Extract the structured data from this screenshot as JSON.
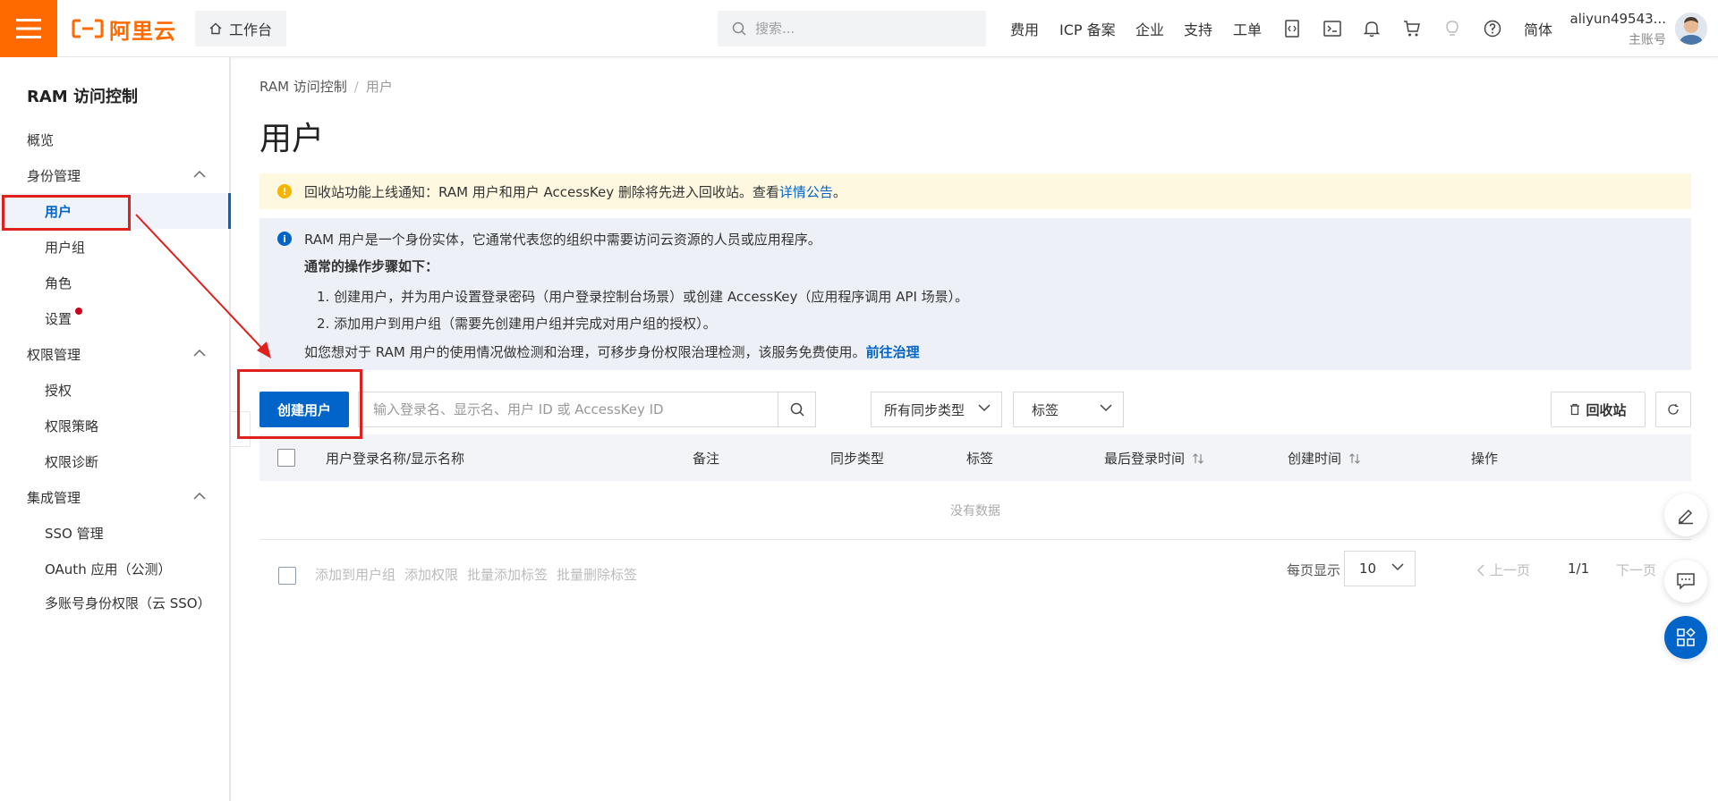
{
  "header": {
    "brand": "阿里云",
    "workbench_label": "工作台",
    "search_placeholder": "搜索...",
    "nav": [
      "费用",
      "ICP 备案",
      "企业",
      "支持",
      "工单"
    ],
    "language": "简体",
    "account_name": "aliyun49543...",
    "account_role": "主账号"
  },
  "sidebar": {
    "title": "RAM 访问控制",
    "overview": "概览",
    "group_identity": "身份管理",
    "users": "用户",
    "user_groups": "用户组",
    "roles": "角色",
    "settings": "设置",
    "group_permissions": "权限管理",
    "authorization": "授权",
    "policies": "权限策略",
    "diagnosis": "权限诊断",
    "group_integration": "集成管理",
    "sso": "SSO 管理",
    "oauth": "OAuth 应用（公测）",
    "cloud_sso": "多账号身份权限（云 SSO）"
  },
  "main": {
    "breadcrumb_root": "RAM 访问控制",
    "breadcrumb_sep": "/",
    "breadcrumb_current": "用户",
    "title": "用户",
    "warn_text": "回收站功能上线通知：RAM 用户和用户 AccessKey 删除将先进入回收站。查看",
    "warn_link": "详情公告",
    "warn_tail": "。",
    "info_line1": "RAM 用户是一个身份实体，它通常代表您的组织中需要访问云资源的人员或应用程序。",
    "info_heading": "通常的操作步骤如下：",
    "info_step1": "1. 创建用户，并为用户设置登录密码（用户登录控制台场景）或创建 AccessKey（应用程序调用 API 场景）。",
    "info_step2": "2. 添加用户到用户组（需要先创建用户组并完成对用户组的授权）。",
    "info_line4": "如您想对于 RAM 用户的使用情况做检测和治理，可移步身份权限治理检测，该服务免费使用。",
    "info_link": "前往治理"
  },
  "toolbar": {
    "create_user": "创建用户",
    "search_placeholder": "输入登录名、显示名、用户 ID 或 AccessKey ID",
    "sync_type": "所有同步类型",
    "tag": "标签",
    "recycle_bin": "回收站"
  },
  "table": {
    "columns": [
      "用户登录名称/显示名称",
      "备注",
      "同步类型",
      "标签",
      "最后登录时间",
      "创建时间",
      "操作"
    ],
    "empty": "没有数据",
    "bulk_actions": [
      "添加到用户组",
      "添加权限",
      "批量添加标签",
      "批量删除标签"
    ],
    "page_size_label": "每页显示",
    "page_size": "10",
    "prev": "上一页",
    "page_count": "1/1",
    "next": "下一页"
  },
  "colors": {
    "brand": "#ff6a00",
    "primary": "#0064c8",
    "annotation": "#e0201d",
    "warn_bg": "#fff8e0",
    "info_bg": "#edf1f7"
  }
}
